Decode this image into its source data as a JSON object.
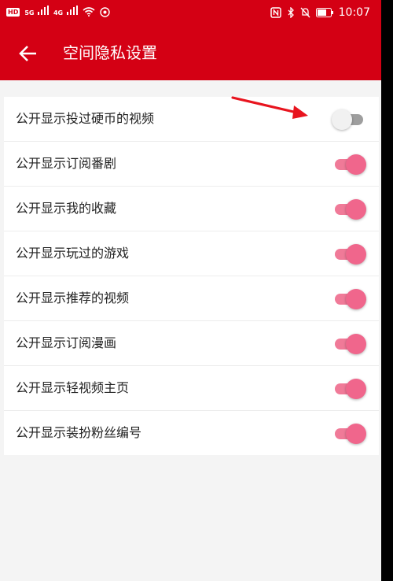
{
  "status_bar": {
    "left_badge": "HD",
    "signal1_label": "5G",
    "signal2_label": "4G",
    "time": "10:07"
  },
  "app_bar": {
    "title": "空间隐私设置",
    "back_icon": "arrow-left-icon"
  },
  "settings": [
    {
      "label": "公开显示投过硬币的视频",
      "enabled": false
    },
    {
      "label": "公开显示订阅番剧",
      "enabled": true
    },
    {
      "label": "公开显示我的收藏",
      "enabled": true
    },
    {
      "label": "公开显示玩过的游戏",
      "enabled": true
    },
    {
      "label": "公开显示推荐的视频",
      "enabled": true
    },
    {
      "label": "公开显示订阅漫画",
      "enabled": true
    },
    {
      "label": "公开显示轻视频主页",
      "enabled": true
    },
    {
      "label": "公开显示装扮粉丝编号",
      "enabled": true
    }
  ],
  "colors": {
    "brand_red": "#d40014",
    "switch_on": "#f0668c",
    "switch_off": "#9e9e9e",
    "annotation_arrow": "#e8141e"
  }
}
